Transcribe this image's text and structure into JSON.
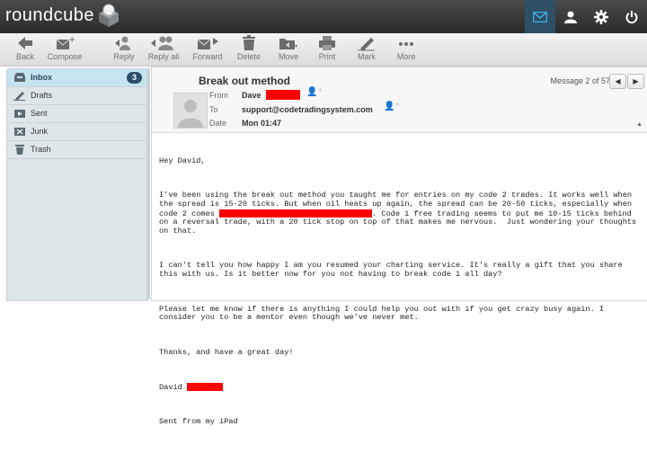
{
  "app": {
    "name": "roundcube"
  },
  "topnav": [
    {
      "icon": "mail-icon",
      "active": true
    },
    {
      "icon": "user-icon",
      "active": false
    },
    {
      "icon": "gear-icon",
      "active": false
    },
    {
      "icon": "power-icon",
      "active": false
    }
  ],
  "toolbar": {
    "back": "Back",
    "compose": "Compose",
    "reply": "Reply",
    "reply_all": "Reply all",
    "forward": "Forward",
    "delete": "Delete",
    "move": "Move",
    "print": "Print",
    "mark": "Mark",
    "more": "More"
  },
  "folders": [
    {
      "label": "Inbox",
      "count": "3",
      "selected": true
    },
    {
      "label": "Drafts"
    },
    {
      "label": "Sent"
    },
    {
      "label": "Junk"
    },
    {
      "label": "Trash"
    }
  ],
  "message": {
    "subject": "Break out method",
    "position": "Message 2 of 57",
    "from_label": "From",
    "from_name": "Dave",
    "to_label": "To",
    "to_value": "support@codetradingsystem.com",
    "date_label": "Date",
    "date_value": "Mon 01:47",
    "body": {
      "greeting": "Hey David,",
      "p1a": "I've been using the break out method you taught me for entries on my code 2 trades. It works well when the spread is 15-20 ticks. But when oil heats up again, the spread can be 20-50 ticks, especially when code 2 comes ",
      "p1b": ". Code 1 free trading seems to put me 10-15 ticks behind on a reversal trade, with a 20 tick stop on top of that makes me nervous.  Just wondering your thoughts on that.",
      "p2": "I can't tell you how happy I am you resumed your charting service. It's really a gift that you share this with us. Is it better now for you not having to break code 1 all day?",
      "p3": "Please let me know if there is anything I could help you out with if you get crazy busy again. I consider you to be a mentor even though we've never met.",
      "p4": "Thanks, and have a great day!",
      "signoff": "David",
      "sent_from": "Sent from my iPad"
    }
  },
  "colors": {
    "redaction": "#ff0000",
    "topbar": "#333333",
    "active_tab": "#2f4f66",
    "badge": "#2a5068"
  }
}
